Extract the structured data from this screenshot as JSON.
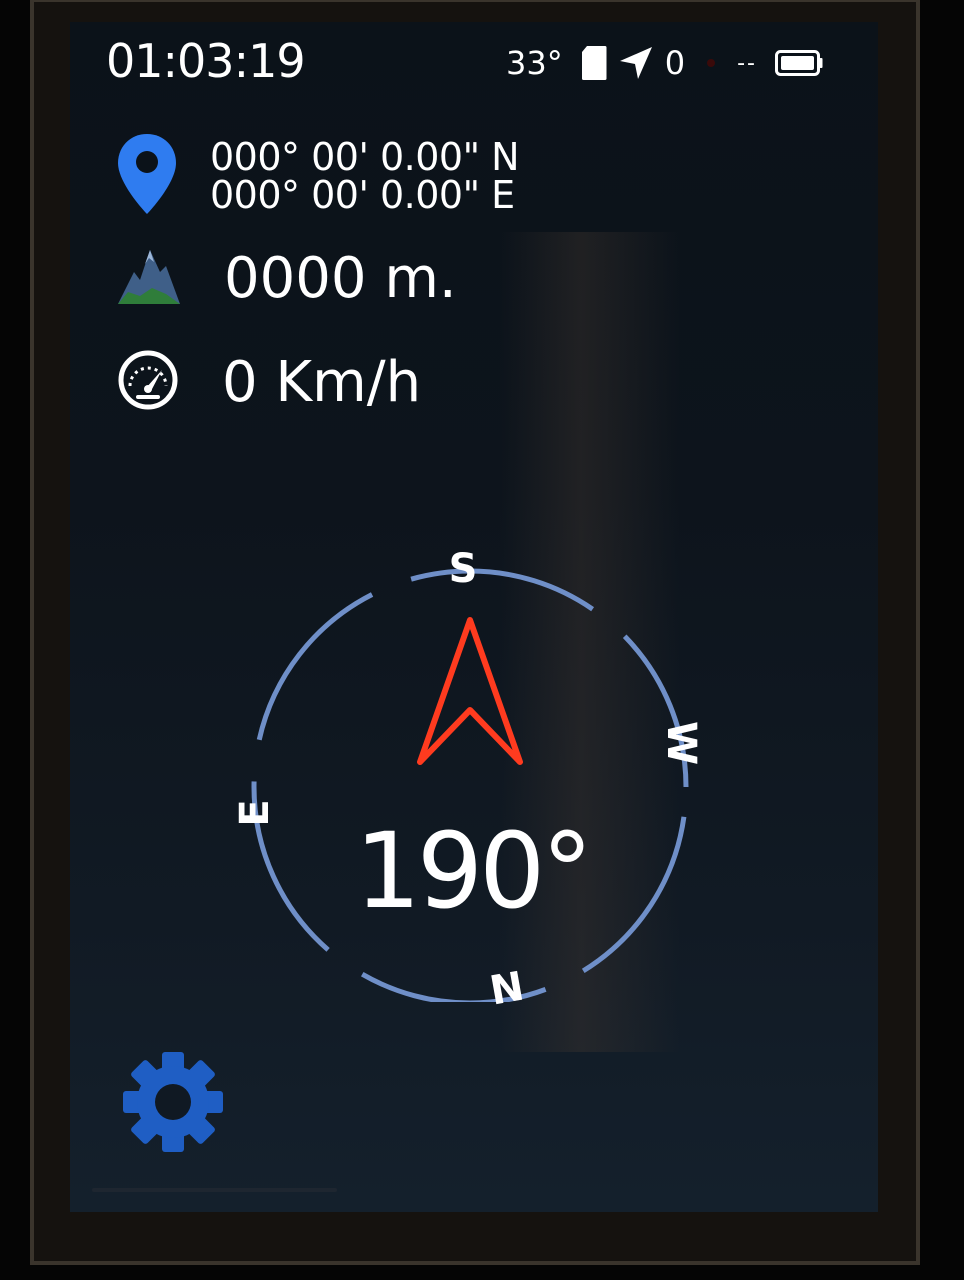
{
  "status_bar": {
    "time": "01:03:19",
    "temperature": "33°",
    "satellites": "0",
    "signal": "--",
    "icons": [
      "sd-card-icon",
      "navigation-arrow-icon",
      "recording-dot-icon",
      "battery-icon"
    ]
  },
  "location": {
    "icon": "map-pin-icon",
    "latitude": "000° 00' 0.00\" N",
    "longitude": "000° 00' 0.00\" E"
  },
  "altitude": {
    "icon": "mountain-icon",
    "value": "0000 m."
  },
  "speed": {
    "icon": "speedometer-icon",
    "value": "0 Km/h"
  },
  "compass": {
    "heading": "190°",
    "heading_degrees": 190,
    "labels": {
      "top": "S",
      "right": "W",
      "bottom": "N",
      "left": "E"
    },
    "ring_color": "#6f8fc8",
    "arrow_color": "#ff3b1f"
  },
  "settings": {
    "icon": "gear-icon",
    "color": "#1f5ec4"
  }
}
